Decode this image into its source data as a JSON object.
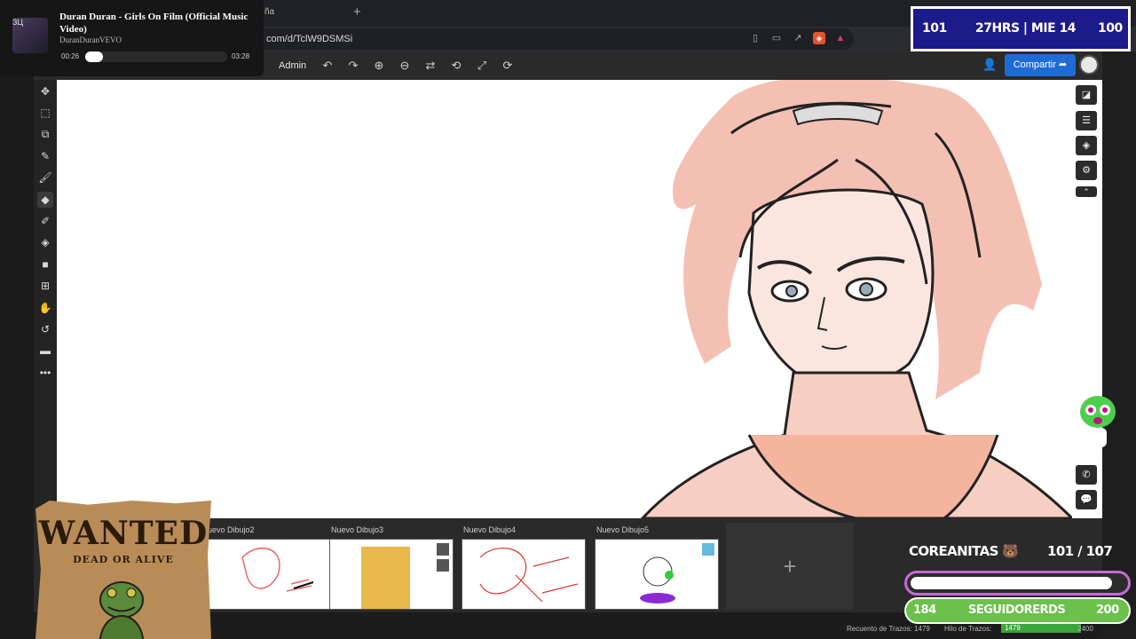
{
  "browser": {
    "tab_partial": "ña",
    "new_tab": "+",
    "url": "com/d/TclW9DSMSi"
  },
  "music": {
    "flag": "ЗЦ",
    "title": "Duran Duran - Girls On Film (Official Music Video)",
    "artist": "DuranDuranVEVO",
    "elapsed": "00:26",
    "duration": "03:28",
    "progress": 0.125
  },
  "toolbar": {
    "admin_label": "Admin",
    "share_label": "Compartir",
    "tools": [
      "undo-icon",
      "redo-icon",
      "zoom-in-icon",
      "zoom-out-icon",
      "flip-icon",
      "rotate-icon",
      "fullscreen-icon",
      "settings-rotate-icon"
    ]
  },
  "left_tools": [
    "move-icon",
    "select-rect-icon",
    "transform-icon",
    "eyedropper-icon",
    "brush-icon",
    "eraser-icon",
    "smudge-icon",
    "fill-icon",
    "shape-icon",
    "add-layer-icon",
    "hand-icon",
    "history-icon",
    "comment-icon",
    "more-icon"
  ],
  "frames": [
    {
      "label": "uevo Dibujo2"
    },
    {
      "label": "Nuevo Dibujo3"
    },
    {
      "label": "Nuevo Dibujo4"
    },
    {
      "label": "Nuevo Dibujo5"
    }
  ],
  "add_frame": "+",
  "status": {
    "strokes_label": "Recuento de Trazos: 1479",
    "thread_label": "Hilo de Trazos:",
    "thread_value": "1479",
    "thread_max": "2400"
  },
  "hud": {
    "left": "101",
    "center": "27HRS | MIE 14",
    "right": "100"
  },
  "goal": {
    "name": "COREANITAS",
    "current": "101",
    "separator": "/",
    "target": "107",
    "progress": 0.944,
    "followers_label": "SEGUIDORERDS",
    "followers_current": "184",
    "followers_target": "200"
  },
  "wanted": {
    "title": "WANTED",
    "subtitle": "DEAD OR ALIVE"
  }
}
